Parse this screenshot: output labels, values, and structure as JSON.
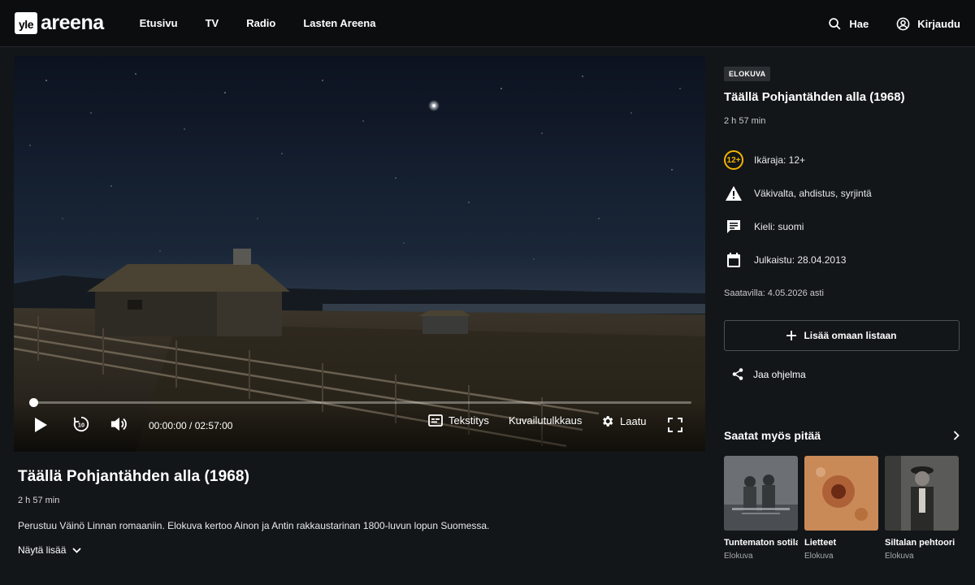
{
  "header": {
    "logo_box": "yle",
    "logo_text": "areena",
    "nav": [
      "Etusivu",
      "TV",
      "Radio",
      "Lasten Areena"
    ],
    "search_label": "Hae",
    "login_label": "Kirjaudu"
  },
  "player": {
    "progress": 0.0,
    "time": "00:00:00 / 02:57:00",
    "subtitles_label": "Tekstitys",
    "audio_description_label": "Kuvailutulkkaus",
    "quality_label": "Laatu"
  },
  "program": {
    "title": "Täällä Pohjantähden alla (1968)",
    "duration": "2 h 57 min",
    "description": "Perustuu Väinö Linnan romaaniin. Elokuva kertoo Ainon ja Antin rakkaustarinan 1800-luvun lopun Suomessa.",
    "show_more": "Näytä lisää"
  },
  "sidebar": {
    "badge": "ELOKUVA",
    "title": "Täällä Pohjantähden alla (1968)",
    "duration": "2 h 57 min",
    "age_icon": "12+",
    "age_rating": "Ikäraja: 12+",
    "warnings": "Väkivalta, ahdistus, syrjintä",
    "language": "Kieli: suomi",
    "published": "Julkaistu: 28.04.2013",
    "available": "Saatavilla: 4.05.2026 asti",
    "add_to_list": "Lisää omaan listaan",
    "share": "Jaa ohjelma"
  },
  "recommendations": {
    "title": "Saatat myös pitää",
    "items": [
      {
        "name": "Tuntematon sotilas",
        "type": "Elokuva"
      },
      {
        "name": "Lietteet",
        "type": "Elokuva"
      },
      {
        "name": "Siltalan pehtoori",
        "type": "Elokuva"
      }
    ]
  },
  "colors": {
    "background": "#131619",
    "header": "#0c0d0f",
    "age_accent": "#f3b400"
  }
}
